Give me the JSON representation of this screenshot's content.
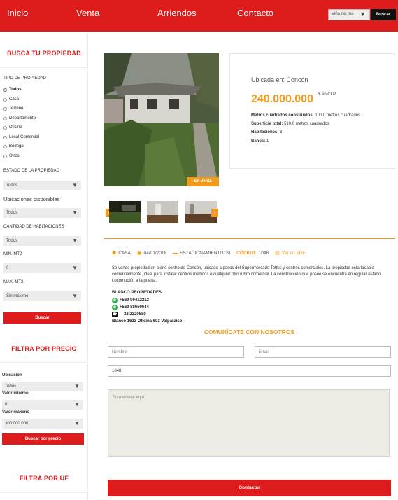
{
  "nav": {
    "links": [
      "Inicio",
      "Venta",
      "Arriendos",
      "Contacto"
    ],
    "location_select": "Viña del ma",
    "search_button": "Buscar"
  },
  "sidebar": {
    "search_title": "BUSCA TU PROPIEDAD",
    "tipo_label": "TIPO DE PROPIEDAD",
    "tipos": [
      "Todos",
      "Casa",
      "Terreno",
      "Departamento",
      "Oficina",
      "Local Comercial",
      "Bodega",
      "Otros"
    ],
    "tipo_selected": "Todos",
    "estado_label": "ESTADO DE LA PROPIEDAD",
    "estado_value": "Todos",
    "ubicaciones_label": "Ubicaciones disponibles",
    "ubicaciones_value": "Todos",
    "habitaciones_label": "CANTIDAD DE HABITACIONES",
    "habitaciones_value": "Todos",
    "min_label": "MIN. MT2",
    "min_value": "0",
    "max_label": "MAX. MT2",
    "max_value": "Sin máximo",
    "buscar_button": "Buscar",
    "precio_title": "FILTRA POR PRECIO",
    "ubicacion_label": "Ubicación",
    "ubicacion_value": "Todos",
    "valor_min_label": "Valor mínimo",
    "valor_min_value": "0",
    "valor_max_label": "Valor máximo",
    "valor_max_value": "300.000.000",
    "buscar_precio_button": "Buscar por precio",
    "uf_title": "FILTRA POR UF"
  },
  "property": {
    "badge": "En Venta",
    "ubicada": "Ubicada en: Concón",
    "price": "240.000.000",
    "currency": "$ en CLP",
    "specs": [
      {
        "label": "Metros cuadrados construidos:",
        "value": "100.0 metros cuadrados"
      },
      {
        "label": "Superficie total:",
        "value": "510.0 metros cuadrados"
      },
      {
        "label": "Habitaciones:",
        "value": "3"
      },
      {
        "label": "Baños:",
        "value": "1"
      }
    ],
    "meta": {
      "type": "CASA",
      "date": "04/01/2018",
      "estacionamiento": "ESTACIONAMIENTO: SI",
      "codigo_label": "CÓDIGO:",
      "codigo": "1048",
      "pdf": "Ver en PDF"
    },
    "description": "Se vende propiedad en pleno centro de Concón, ubicado a pasos del Supermercado Tottus y centros comerciales. La propiedad esta tasable comercialmente, ideal para instalar centros médicos o cualquier otro rubro comercial. La construcción que posee se encuentra en regular estado. Locomoción a la puerta."
  },
  "contact": {
    "company": "BLANCO PROPIEDADES",
    "phone1": "+569 99412212",
    "phone2": "+569 88659644",
    "phone3": "32 2220580",
    "address": "Blanco 1623 Oficina 603 Valparaíso",
    "form_title": "COMUNÍCATE CON NOSOTROS",
    "name_placeholder": "Nombre",
    "email_placeholder": "Email",
    "code_value": "1048",
    "message_placeholder": "Su mensaje aquí",
    "submit": "Contactar"
  },
  "colors": {
    "brand_red": "#de1c1b",
    "accent_orange": "#f39a1a"
  }
}
